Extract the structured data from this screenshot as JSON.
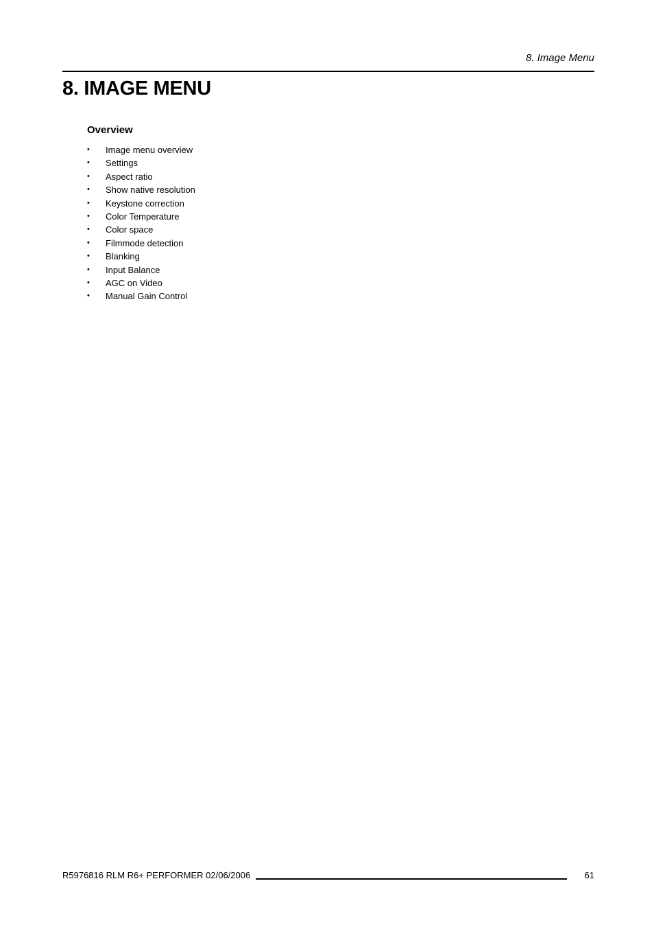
{
  "running_header": "8.  Image Menu",
  "chapter": {
    "title": "8. IMAGE MENU"
  },
  "section": {
    "title": "Overview",
    "bullet": "•",
    "items": [
      "Image menu overview",
      "Settings",
      "Aspect ratio",
      "Show native resolution",
      "Keystone correction",
      "Color Temperature",
      "Color space",
      "Filmmode detection",
      "Blanking",
      "Input Balance",
      "AGC on Video",
      "Manual Gain Control"
    ]
  },
  "footer": {
    "doc_info": "R5976816  RLM R6+ PERFORMER  02/06/2006",
    "page_number": "61"
  }
}
